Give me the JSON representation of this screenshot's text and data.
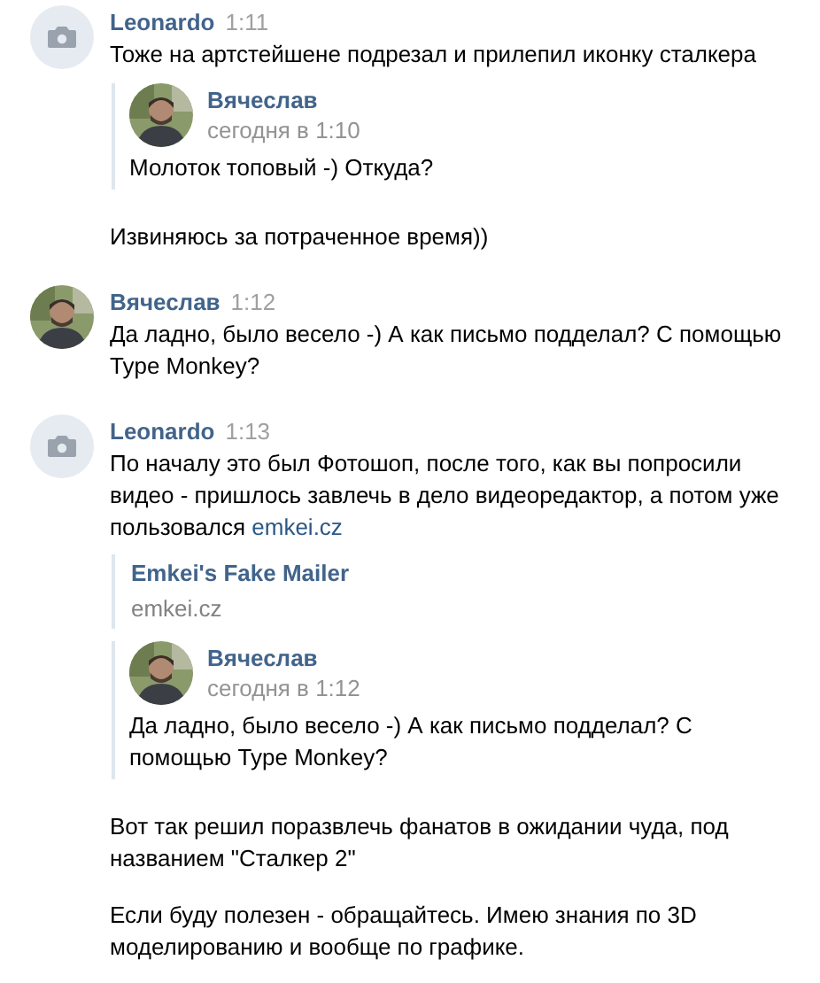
{
  "messages": [
    {
      "author": "Leonardo",
      "time": "1:11",
      "avatar": {
        "kind": "camera"
      },
      "blocks": [
        {
          "kind": "text",
          "text": "Тоже на артстейшене подрезал и прилепил иконку сталкера"
        },
        {
          "kind": "forward",
          "author": "Вячеслав",
          "date": "сегодня в 1:10",
          "text": "Молоток топовый -) Откуда?"
        },
        {
          "kind": "text",
          "text": "Извиняюсь за потраченное время))"
        }
      ]
    },
    {
      "author": "Вячеслав",
      "time": "1:12",
      "blocks": [
        {
          "kind": "text",
          "text": "Да ладно, было весело -) А как письмо подделал? С помощью Type Monkey?"
        }
      ]
    },
    {
      "author": "Leonardo",
      "time": "1:13",
      "avatar": {
        "kind": "camera"
      },
      "blocks": [
        {
          "kind": "text",
          "text": "По началу это был Фотошоп, после того, как вы попросили видео - пришлось завлечь в дело видеоредактор, а потом уже пользовался",
          "link": "emkei.cz"
        },
        {
          "kind": "link_card",
          "title": "Emkei's Fake Mailer",
          "url": "emkei.cz"
        },
        {
          "kind": "forward",
          "author": "Вячеслав",
          "date": "сегодня в 1:12",
          "text": "Да ладно, было весело -) А как письмо подделал? С помощью Type Monkey?"
        },
        {
          "kind": "text",
          "text": "Вот так решил поразвлечь фанатов в ожидании чуда, под названием \"Сталкер 2\""
        },
        {
          "kind": "text",
          "text": "Если буду полезен - обращайтесь. Имею знания по 3D моделированию и вообще по графике."
        }
      ]
    }
  ]
}
